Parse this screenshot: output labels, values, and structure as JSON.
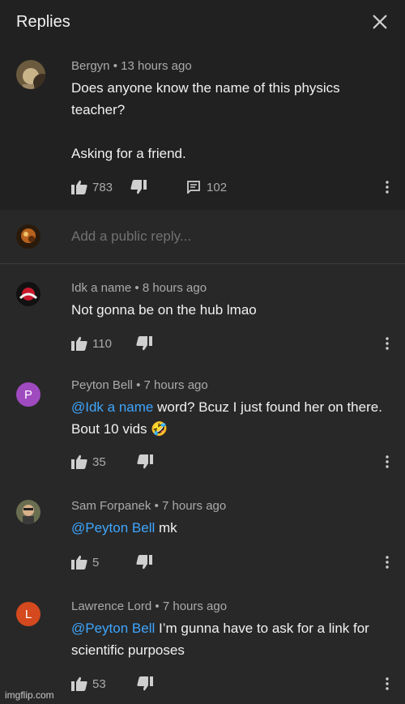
{
  "header": {
    "title": "Replies",
    "close_icon": "close-icon"
  },
  "parent_comment": {
    "author": "Bergyn",
    "time": "13 hours ago",
    "text": "Does anyone know the name of this physics teacher?\n\nAsking for a friend.",
    "likes": "783",
    "replies": "102"
  },
  "reply_box": {
    "placeholder": "Add a public reply..."
  },
  "replies": [
    {
      "author": "Idk a name",
      "time": "8 hours ago",
      "mention": "",
      "text": "Not gonna be on the hub lmao",
      "likes": "110"
    },
    {
      "author": "Peyton Bell",
      "time": "7 hours ago",
      "avatar_letter": "P",
      "mention": "@Idk a name",
      "text": " word? Bcuz I just found her on there. Bout 10 vids 🤣",
      "likes": "35"
    },
    {
      "author": "Sam Forpanek",
      "time": "7 hours ago",
      "mention": "@Peyton Bell",
      "text": " mk",
      "likes": "5"
    },
    {
      "author": "Lawrence Lord",
      "time": "7 hours ago",
      "avatar_letter": "L",
      "mention": "@Peyton Bell",
      "text": " I’m gunna have to ask for a link for scientific purposes",
      "likes": "53"
    }
  ],
  "meta_separator": "•",
  "watermark": "imgflip.com",
  "colors": {
    "background": "#282828",
    "header": "#212121",
    "link": "#3ea6ff",
    "secondary": "#aaaaaa",
    "avatar_p": "#a04ac0",
    "avatar_l": "#d4491d"
  }
}
